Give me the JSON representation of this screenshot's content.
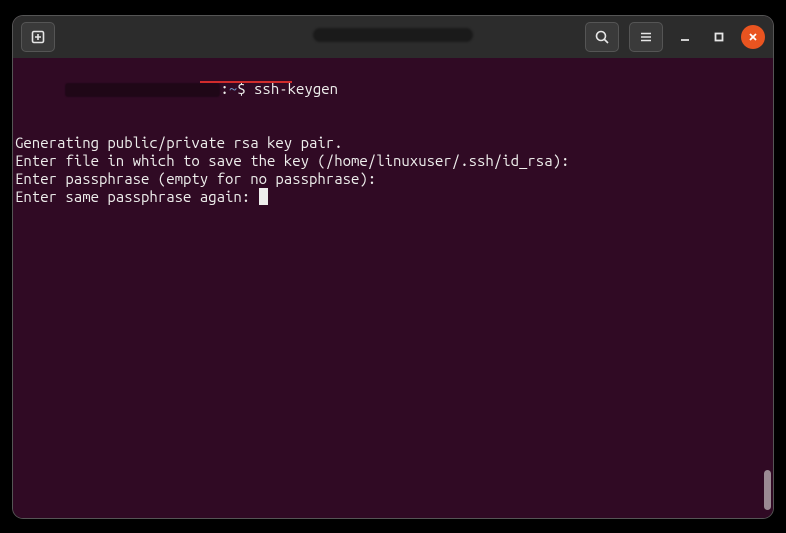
{
  "titlebar": {
    "title_redacted": true
  },
  "prompt": {
    "user_host_redacted": true,
    "separator": ":",
    "path": "~",
    "symbol": "$",
    "command": "ssh-keygen"
  },
  "output": {
    "line1": "Generating public/private rsa key pair.",
    "line2": "Enter file in which to save the key (/home/linuxuser/.ssh/id_rsa):",
    "line3": "Enter passphrase (empty for no passphrase):",
    "line4": "Enter same passphrase again: "
  },
  "icons": {
    "new_tab": "new-tab-icon",
    "search": "search-icon",
    "menu": "hamburger-icon",
    "minimize": "minimize-icon",
    "maximize": "maximize-icon",
    "close": "close-icon"
  },
  "colors": {
    "titlebar_bg": "#2c2c2c",
    "terminal_bg": "#300a24",
    "text": "#eeeeec",
    "path": "#729fcf",
    "close_btn": "#e95420",
    "underline": "#d12c2c"
  }
}
